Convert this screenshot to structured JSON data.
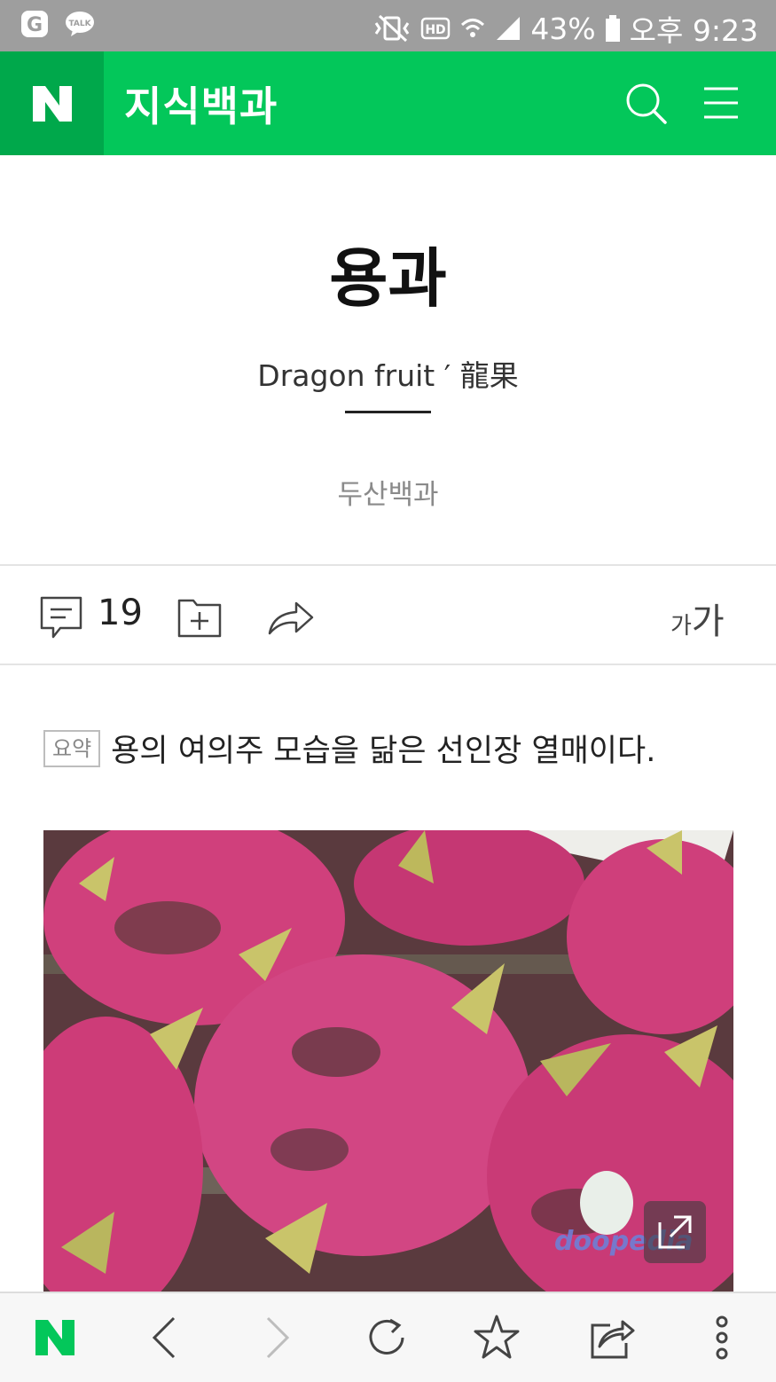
{
  "status_bar": {
    "battery": "43%",
    "time": "오후 9:23",
    "icons": [
      "kakao-g-icon",
      "kakaotalk-icon",
      "vibrate-icon",
      "hd-icon",
      "wifi-icon",
      "signal-icon",
      "battery-icon"
    ]
  },
  "app_bar": {
    "logo": "N",
    "title": "지식백과",
    "icons": [
      "search-icon",
      "menu-icon"
    ]
  },
  "article": {
    "title": "용과",
    "subtitle": "Dragon fruit ′ 龍果",
    "source": "두산백과"
  },
  "toolbar": {
    "comment_count": "19",
    "font_size_label_small": "가",
    "font_size_label_large": "가",
    "icons": [
      "comment-icon",
      "save-folder-icon",
      "share-arrow-icon"
    ]
  },
  "summary": {
    "tag": "요약",
    "text": "용의 여의주 모습을 닮은 선인장 열매이다."
  },
  "image": {
    "watermark": "doopedia",
    "icons": [
      "expand-icon"
    ]
  },
  "bottom_bar": {
    "logo": "N",
    "icons": [
      "naver-home-icon",
      "back-icon",
      "forward-icon",
      "reload-icon",
      "bookmark-star-icon",
      "share-icon",
      "more-vertical-icon"
    ]
  },
  "colors": {
    "brand_green": "#03c75a",
    "brand_green_dark": "#00a84b",
    "status_bar": "#9e9e9e"
  }
}
